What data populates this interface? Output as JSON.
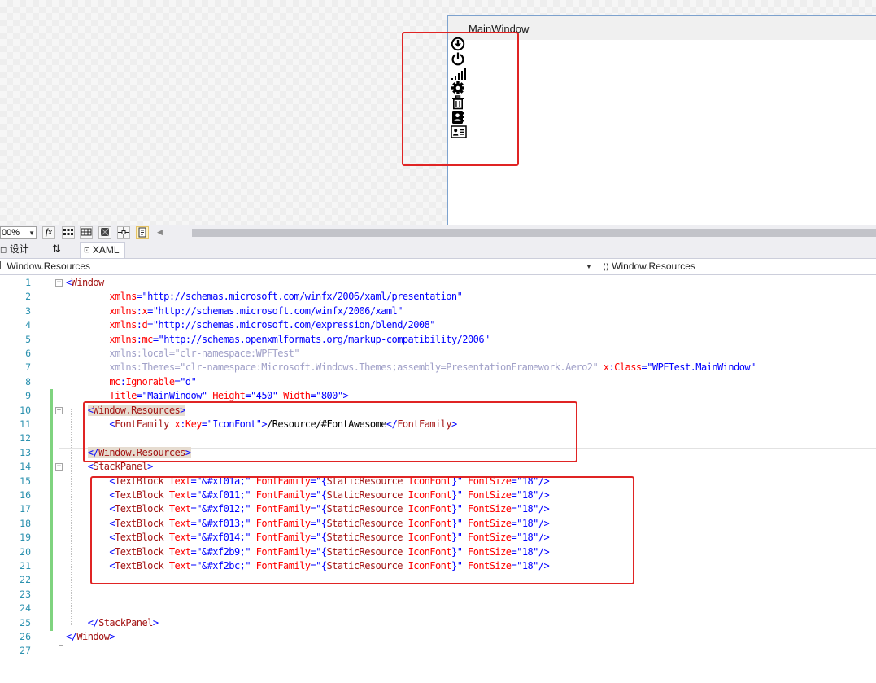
{
  "preview": {
    "window_title": "MainWindow",
    "icons": [
      "download-icon",
      "power-icon",
      "signal-icon",
      "gear-icon",
      "trash-icon",
      "contact-book-icon",
      "id-card-icon"
    ]
  },
  "toolbar": {
    "zoom": "00%",
    "buttons": [
      "fx-icon",
      "grid-icon",
      "snap-grid-icon",
      "artboard-icon",
      "snap-lines-icon",
      "code-icon"
    ]
  },
  "tabs": [
    {
      "label": "设计",
      "icon": "design-icon"
    },
    {
      "label": "⇅",
      "icon": "swap-icon"
    },
    {
      "label": "XAML",
      "icon": "xaml-icon"
    }
  ],
  "navbar": {
    "left": "Window.Resources",
    "right": "Window.Resources"
  },
  "code_lines": [
    [
      [
        "<",
        "bl"
      ],
      [
        "Window",
        "el"
      ]
    ],
    [
      [
        "        xmlns",
        "at"
      ],
      [
        "=\"",
        "bl"
      ],
      [
        "http://schemas.microsoft.com/winfx/2006/xaml/presentation",
        "bl"
      ],
      [
        "\"",
        "bl"
      ]
    ],
    [
      [
        "        xmlns",
        "at"
      ],
      [
        ":",
        "bl"
      ],
      [
        "x",
        "at"
      ],
      [
        "=\"",
        "bl"
      ],
      [
        "http://schemas.microsoft.com/winfx/2006/xaml",
        "bl"
      ],
      [
        "\"",
        "bl"
      ]
    ],
    [
      [
        "        xmlns",
        "at"
      ],
      [
        ":",
        "bl"
      ],
      [
        "d",
        "at"
      ],
      [
        "=\"",
        "bl"
      ],
      [
        "http://schemas.microsoft.com/expression/blend/2008",
        "bl"
      ],
      [
        "\"",
        "bl"
      ]
    ],
    [
      [
        "        xmlns",
        "at"
      ],
      [
        ":",
        "bl"
      ],
      [
        "mc",
        "at"
      ],
      [
        "=\"",
        "bl"
      ],
      [
        "http://schemas.openxmlformats.org/markup-compatibility/2006",
        "bl"
      ],
      [
        "\"",
        "bl"
      ]
    ],
    [
      [
        "        xmlns:local=\"clr-namespace:WPFTest\"",
        "dim"
      ]
    ],
    [
      [
        "        xmlns:Themes=\"clr-namespace:Microsoft.Windows.Themes;assembly=PresentationFramework.Aero2\"",
        "dim"
      ],
      [
        " x",
        "at"
      ],
      [
        ":",
        "bl"
      ],
      [
        "Class",
        "at"
      ],
      [
        "=\"",
        "bl"
      ],
      [
        "WPFTest.MainWindow",
        "bl"
      ],
      [
        "\"",
        "bl"
      ]
    ],
    [
      [
        "        mc",
        "at"
      ],
      [
        ":",
        "bl"
      ],
      [
        "Ignorable",
        "at"
      ],
      [
        "=\"",
        "bl"
      ],
      [
        "d",
        "bl"
      ],
      [
        "\"",
        "bl"
      ]
    ],
    [
      [
        "        Title",
        "at"
      ],
      [
        "=\"",
        "bl"
      ],
      [
        "MainWindow",
        "bl"
      ],
      [
        "\"",
        "bl"
      ],
      [
        " Height",
        "at"
      ],
      [
        "=\"",
        "bl"
      ],
      [
        "450",
        "bl"
      ],
      [
        "\"",
        "bl"
      ],
      [
        " Width",
        "at"
      ],
      [
        "=\"",
        "bl"
      ],
      [
        "800",
        "bl"
      ],
      [
        "\">",
        "bl"
      ]
    ],
    [
      [
        "    ",
        "tx"
      ],
      [
        "<Window.Resources>",
        "hl"
      ]
    ],
    [
      [
        "        ",
        "tx"
      ],
      [
        "<",
        "bl"
      ],
      [
        "FontFamily",
        "el"
      ],
      [
        " x",
        "at"
      ],
      [
        ":",
        "bl"
      ],
      [
        "Key",
        "at"
      ],
      [
        "=\"",
        "bl"
      ],
      [
        "IconFont",
        "bl"
      ],
      [
        "\">",
        "bl"
      ],
      [
        "/Resource/#FontAwesome",
        "tx"
      ],
      [
        "</",
        "bl"
      ],
      [
        "FontFamily",
        "el"
      ],
      [
        ">",
        "bl"
      ]
    ],
    [],
    [
      [
        "    ",
        "tx"
      ],
      [
        "</Window.Resources>",
        "hl"
      ]
    ],
    [
      [
        "    ",
        "tx"
      ],
      [
        "<",
        "bl"
      ],
      [
        "StackPanel",
        "el"
      ],
      [
        ">",
        "bl"
      ]
    ],
    [
      [
        "        ",
        "tx"
      ],
      [
        "<",
        "bl"
      ],
      [
        "TextBlock",
        "el"
      ],
      [
        " Text",
        "at"
      ],
      [
        "=\"",
        "bl"
      ],
      [
        "&#xf01a;",
        "bl"
      ],
      [
        "\"",
        "bl"
      ],
      [
        " FontFamily",
        "at"
      ],
      [
        "=\"",
        "bl"
      ],
      [
        "{",
        "bl"
      ],
      [
        "StaticResource",
        "el"
      ],
      [
        " IconFont",
        "at"
      ],
      [
        "}",
        "bl"
      ],
      [
        "\"",
        "bl"
      ],
      [
        " FontSize",
        "at"
      ],
      [
        "=\"",
        "bl"
      ],
      [
        "18",
        "bl"
      ],
      [
        "\"/>",
        "bl"
      ]
    ],
    [
      [
        "        ",
        "tx"
      ],
      [
        "<",
        "bl"
      ],
      [
        "TextBlock",
        "el"
      ],
      [
        " Text",
        "at"
      ],
      [
        "=\"",
        "bl"
      ],
      [
        "&#xf011;",
        "bl"
      ],
      [
        "\"",
        "bl"
      ],
      [
        " FontFamily",
        "at"
      ],
      [
        "=\"",
        "bl"
      ],
      [
        "{",
        "bl"
      ],
      [
        "StaticResource",
        "el"
      ],
      [
        " IconFont",
        "at"
      ],
      [
        "}",
        "bl"
      ],
      [
        "\"",
        "bl"
      ],
      [
        " FontSize",
        "at"
      ],
      [
        "=\"",
        "bl"
      ],
      [
        "18",
        "bl"
      ],
      [
        "\"/>",
        "bl"
      ]
    ],
    [
      [
        "        ",
        "tx"
      ],
      [
        "<",
        "bl"
      ],
      [
        "TextBlock",
        "el"
      ],
      [
        " Text",
        "at"
      ],
      [
        "=\"",
        "bl"
      ],
      [
        "&#xf012;",
        "bl"
      ],
      [
        "\"",
        "bl"
      ],
      [
        " FontFamily",
        "at"
      ],
      [
        "=\"",
        "bl"
      ],
      [
        "{",
        "bl"
      ],
      [
        "StaticResource",
        "el"
      ],
      [
        " IconFont",
        "at"
      ],
      [
        "}",
        "bl"
      ],
      [
        "\"",
        "bl"
      ],
      [
        " FontSize",
        "at"
      ],
      [
        "=\"",
        "bl"
      ],
      [
        "18",
        "bl"
      ],
      [
        "\"/>",
        "bl"
      ]
    ],
    [
      [
        "        ",
        "tx"
      ],
      [
        "<",
        "bl"
      ],
      [
        "TextBlock",
        "el"
      ],
      [
        " Text",
        "at"
      ],
      [
        "=\"",
        "bl"
      ],
      [
        "&#xf013;",
        "bl"
      ],
      [
        "\"",
        "bl"
      ],
      [
        " FontFamily",
        "at"
      ],
      [
        "=\"",
        "bl"
      ],
      [
        "{",
        "bl"
      ],
      [
        "StaticResource",
        "el"
      ],
      [
        " IconFont",
        "at"
      ],
      [
        "}",
        "bl"
      ],
      [
        "\"",
        "bl"
      ],
      [
        " FontSize",
        "at"
      ],
      [
        "=\"",
        "bl"
      ],
      [
        "18",
        "bl"
      ],
      [
        "\"/>",
        "bl"
      ]
    ],
    [
      [
        "        ",
        "tx"
      ],
      [
        "<",
        "bl"
      ],
      [
        "TextBlock",
        "el"
      ],
      [
        " Text",
        "at"
      ],
      [
        "=\"",
        "bl"
      ],
      [
        "&#xf014;",
        "bl"
      ],
      [
        "\"",
        "bl"
      ],
      [
        " FontFamily",
        "at"
      ],
      [
        "=\"",
        "bl"
      ],
      [
        "{",
        "bl"
      ],
      [
        "StaticResource",
        "el"
      ],
      [
        " IconFont",
        "at"
      ],
      [
        "}",
        "bl"
      ],
      [
        "\"",
        "bl"
      ],
      [
        " FontSize",
        "at"
      ],
      [
        "=\"",
        "bl"
      ],
      [
        "18",
        "bl"
      ],
      [
        "\"/>",
        "bl"
      ]
    ],
    [
      [
        "        ",
        "tx"
      ],
      [
        "<",
        "bl"
      ],
      [
        "TextBlock",
        "el"
      ],
      [
        " Text",
        "at"
      ],
      [
        "=\"",
        "bl"
      ],
      [
        "&#xf2b9;",
        "bl"
      ],
      [
        "\"",
        "bl"
      ],
      [
        " FontFamily",
        "at"
      ],
      [
        "=\"",
        "bl"
      ],
      [
        "{",
        "bl"
      ],
      [
        "StaticResource",
        "el"
      ],
      [
        " IconFont",
        "at"
      ],
      [
        "}",
        "bl"
      ],
      [
        "\"",
        "bl"
      ],
      [
        " FontSize",
        "at"
      ],
      [
        "=\"",
        "bl"
      ],
      [
        "18",
        "bl"
      ],
      [
        "\"/>",
        "bl"
      ]
    ],
    [
      [
        "        ",
        "tx"
      ],
      [
        "<",
        "bl"
      ],
      [
        "TextBlock",
        "el"
      ],
      [
        " Text",
        "at"
      ],
      [
        "=\"",
        "bl"
      ],
      [
        "&#xf2bc;",
        "bl"
      ],
      [
        "\"",
        "bl"
      ],
      [
        " FontFamily",
        "at"
      ],
      [
        "=\"",
        "bl"
      ],
      [
        "{",
        "bl"
      ],
      [
        "StaticResource",
        "el"
      ],
      [
        " IconFont",
        "at"
      ],
      [
        "}",
        "bl"
      ],
      [
        "\"",
        "bl"
      ],
      [
        " FontSize",
        "at"
      ],
      [
        "=\"",
        "bl"
      ],
      [
        "18",
        "bl"
      ],
      [
        "\"/>",
        "bl"
      ]
    ],
    [],
    [],
    [],
    [
      [
        "    ",
        "tx"
      ],
      [
        "</",
        "bl"
      ],
      [
        "StackPanel",
        "el"
      ],
      [
        ">",
        "bl"
      ]
    ],
    [
      [
        "</",
        "bl"
      ],
      [
        "Window",
        "el"
      ],
      [
        ">",
        "bl"
      ]
    ],
    []
  ],
  "fold_markers": [
    1,
    10,
    14
  ],
  "colors": {
    "annotation_red": "#e02424",
    "line_number": "#2b91af",
    "element": "#a31515",
    "attribute": "#ff0000",
    "value": "#0000ff",
    "changed_bar": "#7fd37f"
  }
}
